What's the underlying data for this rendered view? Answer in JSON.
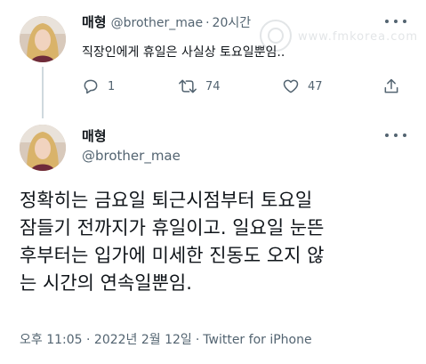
{
  "colors": {
    "text": "#0f1419",
    "secondary": "#536471",
    "thread_line": "#cfd9de"
  },
  "parent_tweet": {
    "display_name": "매형",
    "handle": "@brother_mae",
    "separator": "·",
    "time": "20시간",
    "text": "직장인에게 휴일은 사실상 토요일뿐임..",
    "watermark": "www.fmkorea.com",
    "actions": {
      "reply": {
        "icon": "reply-icon",
        "count": "1"
      },
      "retweet": {
        "icon": "retweet-icon",
        "count": "74"
      },
      "like": {
        "icon": "heart-icon",
        "count": "47"
      },
      "share": {
        "icon": "share-icon"
      }
    }
  },
  "main_tweet": {
    "display_name": "매형",
    "handle": "@brother_mae",
    "body_lines": [
      "정확히는 금요일 퇴근시점부터 토요일",
      "잠들기 전까지가 휴일이고. 일요일 눈뜬",
      "후부터는 입가에 미세한 진동도 오지 않",
      "는 시간의 연속일뿐임."
    ],
    "timestamp": "오후 11:05 · 2022년 2월 12일",
    "separator": "·",
    "source": "Twitter for iPhone"
  }
}
